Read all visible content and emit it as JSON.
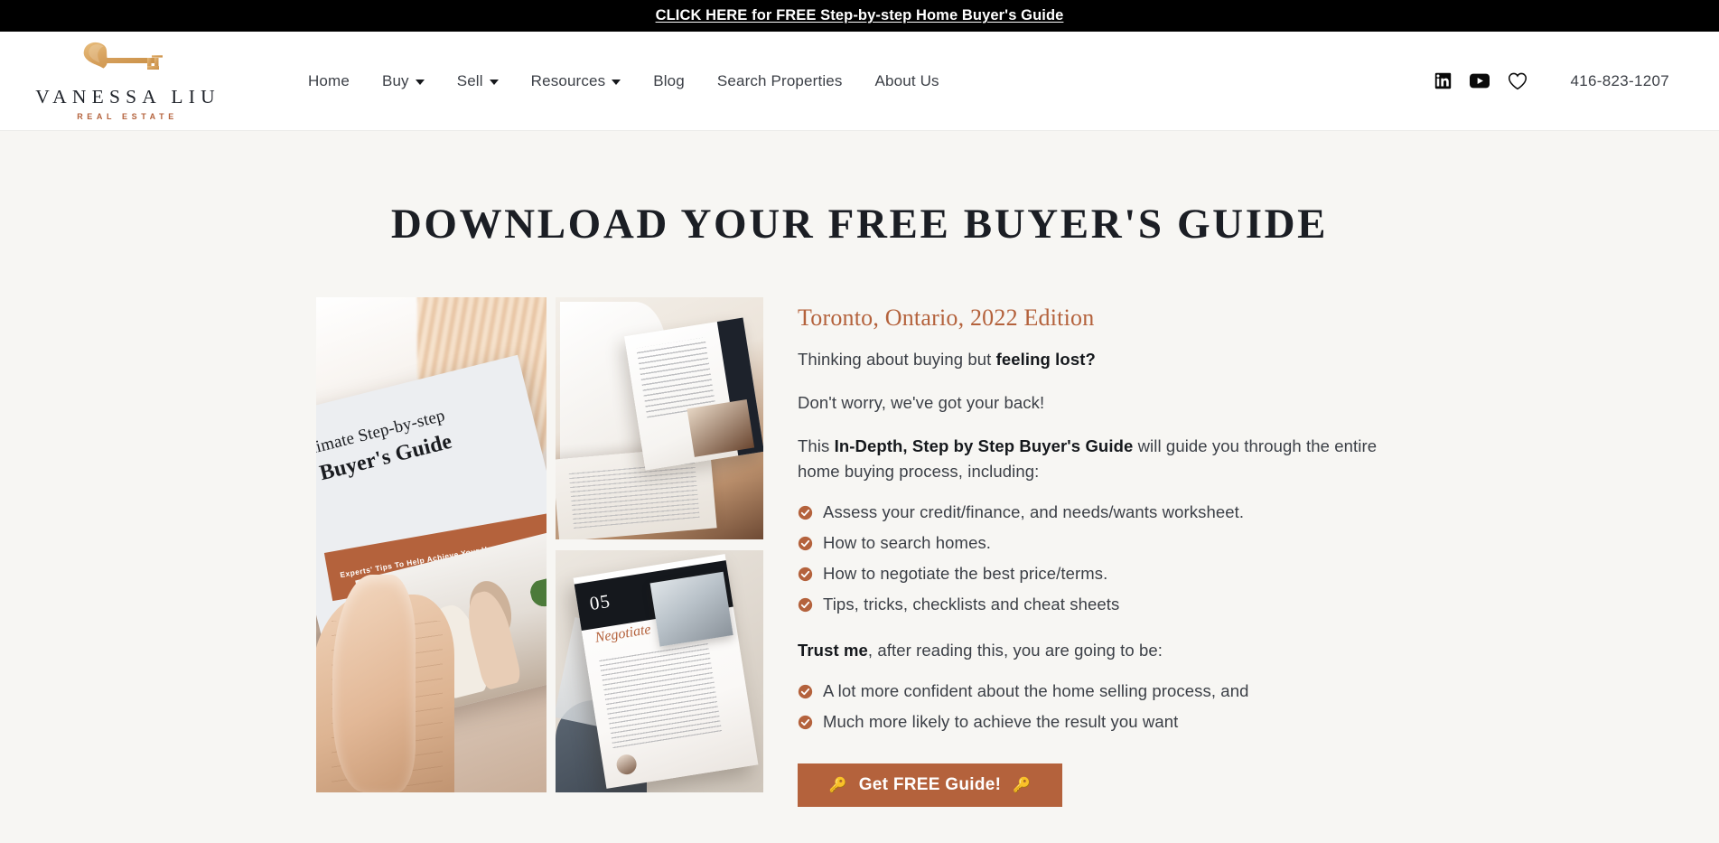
{
  "announcement": {
    "text": "CLICK HERE for FREE Step-by-step Home Buyer's Guide"
  },
  "header": {
    "logo": {
      "name": "VANESSA LIU",
      "tagline": "REAL ESTATE",
      "icon": "gold-key-icon"
    },
    "nav": [
      {
        "label": "Home",
        "has_dropdown": false
      },
      {
        "label": "Buy",
        "has_dropdown": true
      },
      {
        "label": "Sell",
        "has_dropdown": true
      },
      {
        "label": "Resources",
        "has_dropdown": true
      },
      {
        "label": "Blog",
        "has_dropdown": false
      },
      {
        "label": "Search Properties",
        "has_dropdown": false
      },
      {
        "label": "About Us",
        "has_dropdown": false
      }
    ],
    "social": [
      {
        "name": "linkedin-icon"
      },
      {
        "name": "youtube-icon"
      },
      {
        "name": "heart-icon"
      }
    ],
    "phone": "416-823-1207"
  },
  "main": {
    "title": "DOWNLOAD YOUR FREE BUYER'S GUIDE",
    "edition": "Toronto, Ontario, 2022 Edition",
    "lead_plain": "Thinking about buying but ",
    "lead_bold": "feeling lost?",
    "reassure": "Don't worry, we've got your back!",
    "desc_pre": "This ",
    "desc_bold": "In-Depth, Step by Step Buyer's Guide",
    "desc_post": " will guide you through the entire home buying process, including:",
    "features": [
      "Assess your credit/finance, and needs/wants worksheet.",
      "How to search homes.",
      "How to negotiate the best price/terms.",
      "Tips, tricks, checklists and cheat sheets"
    ],
    "trust_bold": "Trust me",
    "trust_rest": ", after reading this, you are going to be:",
    "outcomes": [
      "A lot more confident about the home selling process, and",
      "Much more likely to achieve the result you want"
    ],
    "cta_label": "Get FREE Guide!",
    "cta_icon": "key-emoji"
  },
  "collage": {
    "cover": {
      "title_line1": "Ultimate Step-by-step",
      "title_line2": "Buyer's Guide",
      "band": "Experts' Tips To Help Achieve Your Home Goals"
    },
    "chapter": {
      "number": "05",
      "name": "Negotiate"
    }
  },
  "colors": {
    "accent_copper": "#b4623c",
    "page_background": "#f7f6f3",
    "header_background": "#ffffff",
    "announcement_background": "#000000",
    "text": "#3b3f46"
  }
}
